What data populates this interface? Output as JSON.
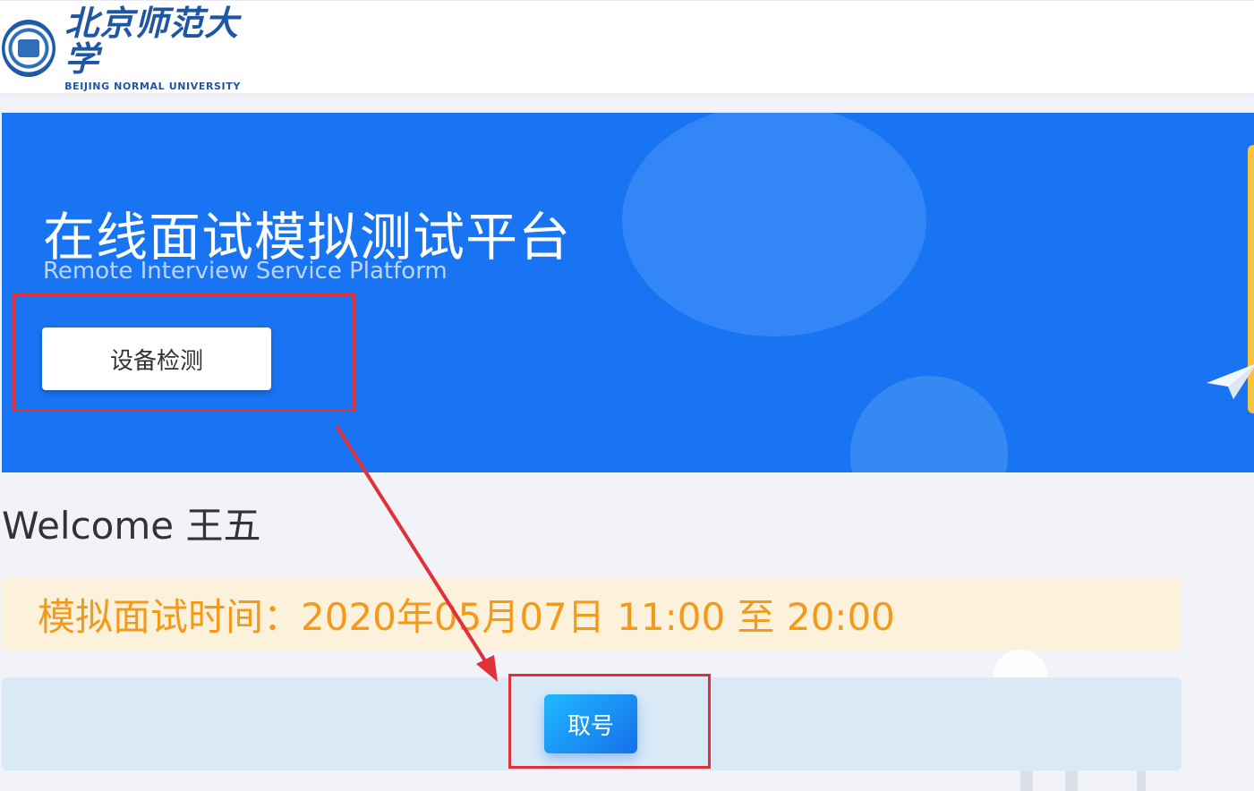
{
  "header": {
    "logo_name_cn": "北京师范大学",
    "logo_name_en": "BEIJING NORMAL UNIVERSITY"
  },
  "banner": {
    "title": "在线面试模拟测试平台",
    "subtitle": "Remote Interview Service Platform",
    "device_check_label": "设备检测",
    "background_color": "#1874f2"
  },
  "welcome": {
    "text": "Welcome 王五"
  },
  "schedule": {
    "time_text": "模拟面试时间：2020年05月07日 11:00 至 20:00",
    "text_color": "#f39a1b"
  },
  "actions": {
    "take_number_label": "取号"
  },
  "annotation": {
    "highlight_color": "#e0303a"
  }
}
